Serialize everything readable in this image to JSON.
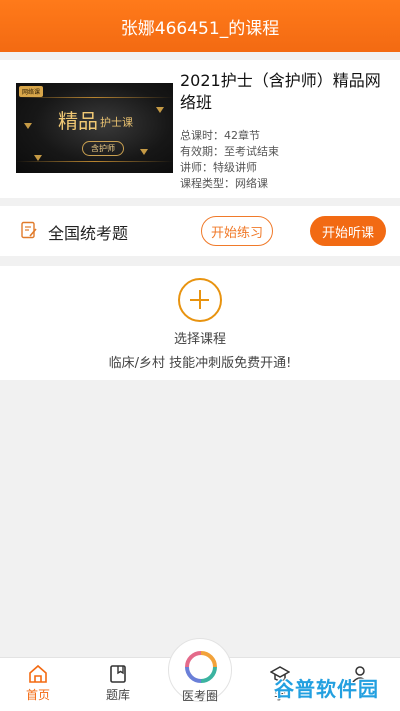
{
  "header": {
    "title": "张娜466451_的课程"
  },
  "course": {
    "thumbnail": {
      "tag": "网络课",
      "main_text": "精品",
      "sub_text": "护士课",
      "badge": "含护师"
    },
    "title": "2021护士（含护师）精品网络班",
    "meta": [
      "总课时：42章节",
      "有效期：至考试结束",
      "讲师：特级讲师",
      "课程类型：网络课"
    ]
  },
  "exam": {
    "label": "全国统考题",
    "practice_button": "开始练习",
    "listen_button": "开始听课",
    "icon": "edit-note-icon"
  },
  "select_course": {
    "icon": "plus-circle-icon",
    "label": "选择课程",
    "subtitle": "临床/乡村 技能冲刺版免费开通!"
  },
  "tabbar": {
    "items": [
      {
        "label": "首页",
        "icon": "home-icon",
        "active": true
      },
      {
        "label": "题库",
        "icon": "book-icon",
        "active": false
      },
      {
        "label": "医考圈",
        "icon": "circle-logo-icon",
        "active": false
      },
      {
        "label": "学",
        "icon": "graduation-cap-icon",
        "active": false
      },
      {
        "label": "",
        "icon": "user-icon",
        "active": false
      }
    ]
  },
  "watermark": {
    "text": "谷普软件园"
  },
  "colors": {
    "accent": "#f36a12",
    "plus": "#e8930f",
    "watermark": "#23a0e0"
  }
}
